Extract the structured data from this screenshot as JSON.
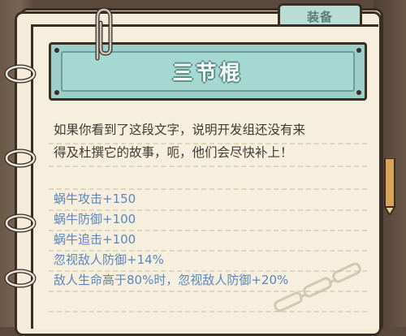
{
  "tab": {
    "label": "装备"
  },
  "title": {
    "text": "三节棍"
  },
  "description": {
    "line1": "如果你看到了这段文字，说明开发组还没有来",
    "line2": "得及杜撰它的故事，呃，他们会尽快补上！"
  },
  "stats": [
    {
      "text": "蜗牛攻击+150"
    },
    {
      "text": "蜗牛防御+100"
    },
    {
      "text": "蜗牛追击+100"
    },
    {
      "text": "忽视敌人防御+14%"
    },
    {
      "text": "敌人生命高于80%时，忽视敌人防御+20%"
    }
  ],
  "colors": {
    "banner": "#9ccfca",
    "stat_text": "#5b86bd",
    "paper": "#f6efde",
    "outline": "#3a2e24"
  }
}
